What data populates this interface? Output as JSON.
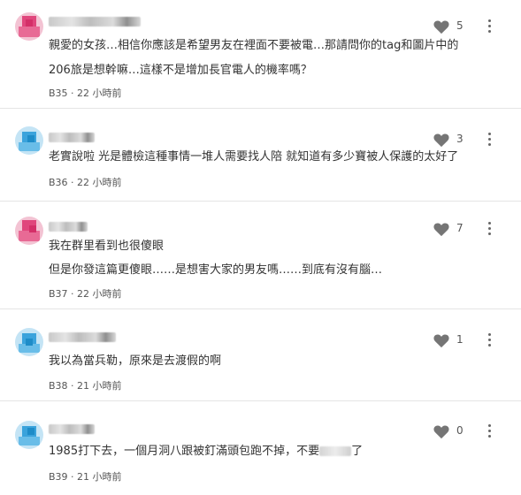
{
  "comments": [
    {
      "lines": [
        "親愛的女孩…相信你應該是希望男友在裡面不要被電…那請問你的tag和圖片中的",
        "206旅是想幹嘛…這樣不是增加長官電人的機率嗎？"
      ],
      "floor": "B35",
      "time": "22 小時前",
      "likes": "5"
    },
    {
      "lines": [
        "老實說啦 光是體檢這種事情一堆人需要找人陪 就知道有多少寶被人保護的太好了"
      ],
      "floor": "B36",
      "time": "22 小時前",
      "likes": "3"
    },
    {
      "lines": [
        "我在群里看到也很傻眼",
        "但是你發這篇更傻眼……是想害大家的男友嗎……到底有沒有腦…"
      ],
      "floor": "B37",
      "time": "22 小時前",
      "likes": "7"
    },
    {
      "lines": [
        "我以為當兵勒，原來是去渡假的啊"
      ],
      "floor": "B38",
      "time": "21 小時前",
      "likes": "1"
    },
    {
      "lines_b39_pre": "1985打下去，一個月洞八跟被釘滿頭包跑不掉，不要",
      "lines_b39_post": "了",
      "floor": "B39",
      "time": "21 小時前",
      "likes": "0"
    }
  ],
  "meta_separator": "·",
  "icons": {
    "like": "heart-icon",
    "more": "more-vertical-icon"
  },
  "colors": {
    "avatar_pink": "#e0467c",
    "avatar_blue": "#3aa3dc",
    "text": "#333333",
    "divider": "#e5e5e5"
  }
}
